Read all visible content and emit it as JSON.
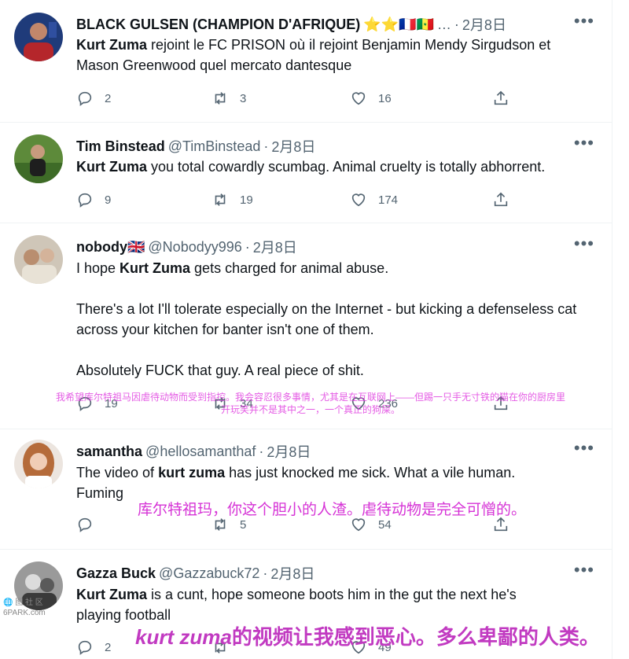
{
  "tweets": [
    {
      "name": "BLACK GULSEN (CHAMPION D'AFRIQUE)",
      "handle": "",
      "name_suffix": "⭐⭐🇫🇷🇸🇳",
      "handle_trunc": "…",
      "date": "2月8日",
      "body_bold": "Kurt Zuma",
      "body_rest": " rejoint le FC PRISON où il rejoint Benjamin Mendy Sirgudson et Mason Greenwood quel mercato dantesque",
      "replies": "2",
      "retweets": "3",
      "likes": "16"
    },
    {
      "name": "Tim Binstead",
      "handle": "@TimBinstead",
      "date": "2月8日",
      "body_bold": "Kurt Zuma",
      "body_rest": " you total cowardly scumbag. Animal cruelty is totally abhorrent.",
      "replies": "9",
      "retweets": "19",
      "likes": "174"
    },
    {
      "name": "nobody🇬🇧",
      "handle": "@Nobodyy996",
      "date": "2月8日",
      "body_pre": "I hope ",
      "body_bold": "Kurt Zuma",
      "body_rest": " gets charged for animal abuse.",
      "body_p2": "There's a lot I'll tolerate especially on the Internet - but kicking a defenseless cat across your kitchen for banter isn't one of them.",
      "body_p3": "Absolutely FUCK that guy. A real piece of shit.",
      "replies": "19",
      "retweets": "34",
      "likes": "236"
    },
    {
      "name": "samantha",
      "handle": "@hellosamanthaf",
      "date": "2月8日",
      "body_pre": "The video of ",
      "body_bold": "kurt zuma",
      "body_rest": " has just knocked me sick. What a vile human. Fuming",
      "replies": "",
      "retweets": "5",
      "likes": "54"
    },
    {
      "name": "Gazza Buck",
      "handle": "@Gazzabuck72",
      "date": "2月8日",
      "body_bold": "Kurt Zuma",
      "body_rest": " is a cunt, hope someone boots him in the gut the next he's playing football",
      "replies": "2",
      "retweets": "",
      "likes": "49"
    }
  ],
  "overlays": {
    "translation_1_line1": "我希望库尔特祖马因虐待动物而受到指控。我会容忍很多事情，尤其是在互联网上——但踢一只手无寸铁的猫在你的厨房里",
    "translation_1_line2": "开玩笑并不是其中之一，一个真正的狗屎。",
    "translation_2": "库尔特祖玛，你这个胆小的人渣。虐待动物是完全可憎的。",
    "translation_3_ital": "kurt zuma",
    "translation_3_rest": "的视频让我感到恶心。多么卑鄙的人类。"
  },
  "watermark": {
    "line1": "🌐 图 社 区",
    "line2": "6PARK.com"
  },
  "icons": [
    "reply-icon",
    "retweet-icon",
    "like-icon",
    "share-icon",
    "more-icon"
  ],
  "colors": {
    "secondary_text": "#536471",
    "overlay": "#d633d6",
    "divider": "#eff3f4"
  }
}
